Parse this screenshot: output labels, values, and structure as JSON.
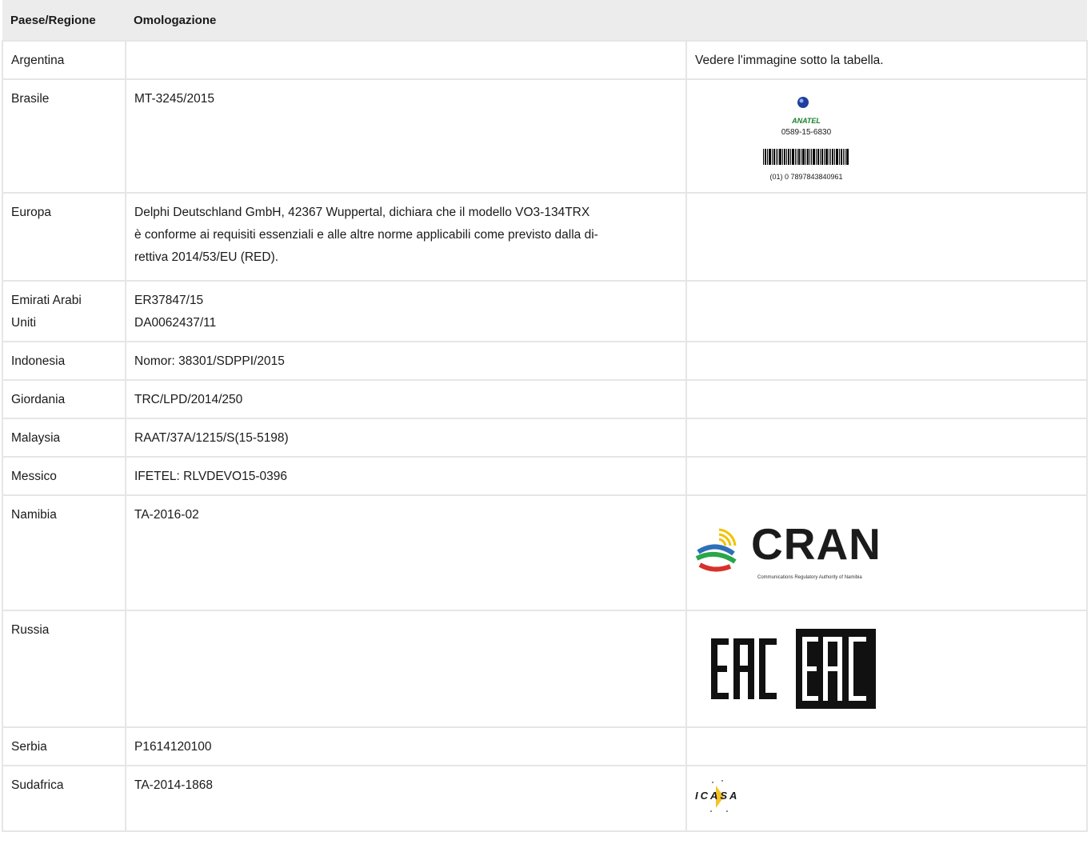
{
  "headers": {
    "country": "Paese/Regione",
    "approval": "Omologazione"
  },
  "rows": {
    "argentina": {
      "country": "Argentina",
      "approval": "",
      "note": "Vedere l'immagine sotto la tabella."
    },
    "brasile": {
      "country": "Brasile",
      "approval": "MT-3245/2015",
      "logo_brand": "ANATEL",
      "logo_cert": "0589-15-6830",
      "logo_barcode": "(01) 0 7897843840961"
    },
    "europa": {
      "country": "Europa",
      "approval_lines": [
        "Delphi Deutschland GmbH, 42367 Wuppertal, dichiara che il modello VO3-134TRX",
        "è conforme ai requisiti essenziali e alle altre norme applicabili come previsto dalla di-",
        "rettiva 2014/53/EU (RED)."
      ]
    },
    "uae": {
      "country_lines": [
        "Emirati Arabi",
        "Uniti"
      ],
      "approval_lines": [
        "ER37847/15",
        "DA0062437/11"
      ]
    },
    "indonesia": {
      "country": "Indonesia",
      "approval": "Nomor: 38301/SDPPI/2015"
    },
    "giordania": {
      "country": "Giordania",
      "approval": "TRC/LPD/2014/250"
    },
    "malaysia": {
      "country": "Malaysia",
      "approval": "RAAT/37A/1215/S(15-5198)"
    },
    "messico": {
      "country": "Messico",
      "approval": "IFETEL: RLVDEVO15-0396"
    },
    "namibia": {
      "country": "Namibia",
      "approval": "TA-2016-02",
      "logo_word": "CRAN",
      "logo_sub": "Communications Regulatory Authority of Namibia"
    },
    "russia": {
      "country": "Russia",
      "approval": ""
    },
    "serbia": {
      "country": "Serbia",
      "approval": "P1614120100"
    },
    "sudafrica": {
      "country": "Sudafrica",
      "approval": "TA-2014-1868",
      "logo_word": "ICASA"
    }
  }
}
